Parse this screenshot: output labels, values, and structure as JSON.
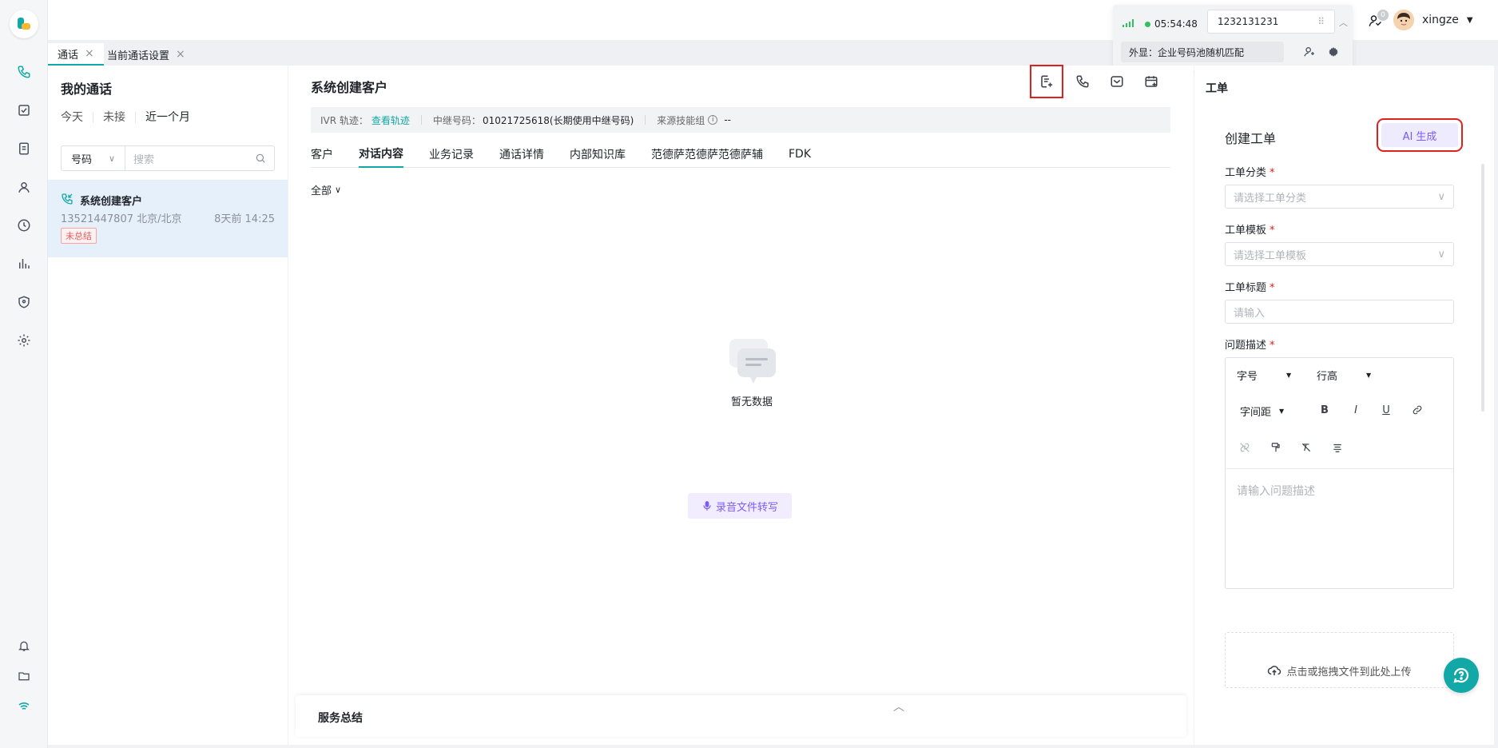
{
  "tabs": [
    {
      "label": "通话"
    },
    {
      "label": "当前通话设置"
    }
  ],
  "call_panel": {
    "timer": "05:54:48",
    "number": "1232131231",
    "outbound_display": "外显：企业号码池随机匹配"
  },
  "user": {
    "name": "xingze",
    "badge": "0"
  },
  "my_calls": {
    "title": "我的通话",
    "filters": [
      "今天",
      "未接",
      "近一个月"
    ],
    "search_type": "号码",
    "search_placeholder": "搜索",
    "items": [
      {
        "name": "系统创建客户",
        "phone_location": "13521447807 北京/北京",
        "time": "8天前 14:25",
        "tag": "未总结"
      }
    ]
  },
  "main": {
    "title": "系统创建客户",
    "info": {
      "ivr_label": "IVR 轨迹：",
      "ivr_link": "查看轨迹",
      "trunk_label": "中继号码：",
      "trunk_value": "01021725618(长期使用中继号码)",
      "skill_label": "来源技能组",
      "skill_value": "--"
    },
    "tabs": [
      "客户",
      "对话内容",
      "业务记录",
      "通话详情",
      "内部知识库",
      "范德萨范德萨范德萨辅",
      "FDK"
    ],
    "active_tab": "对话内容",
    "filter": "全部",
    "empty_text": "暂无数据",
    "transcribe_button": "录音文件转写",
    "summary_title": "服务总结"
  },
  "ticket": {
    "panel_title": "工单",
    "card_title": "创建工单",
    "ai_button": "AI 生成",
    "category_label": "工单分类",
    "category_placeholder": "请选择工单分类",
    "template_label": "工单模板",
    "template_placeholder": "请选择工单模板",
    "title_label": "工单标题",
    "title_placeholder": "请输入",
    "desc_label": "问题描述",
    "toolbar": {
      "font_size": "字号",
      "line_height": "行高",
      "letter_spacing": "字间距"
    },
    "desc_placeholder": "请输入问题描述",
    "upload_text": "点击或拖拽文件到此处上传",
    "required_mark": "*"
  },
  "colors": {
    "accent": "#13a8a8",
    "highlight": "#e0201c",
    "ai": "#7b5cf5"
  }
}
